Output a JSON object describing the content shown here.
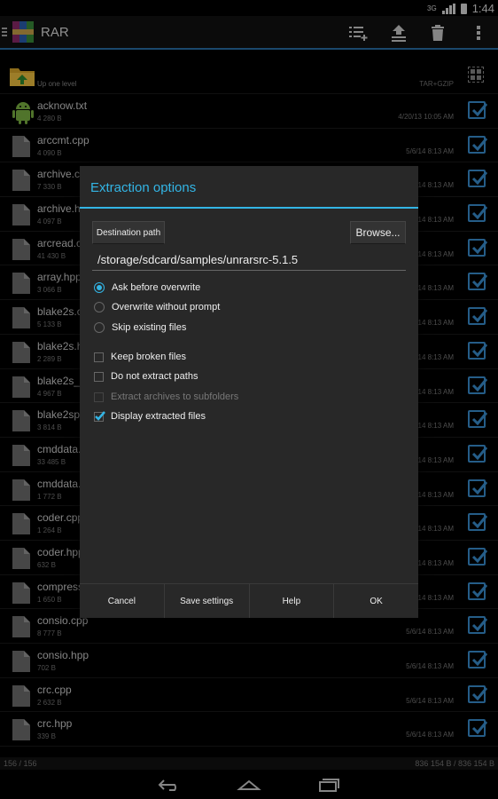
{
  "status_bar": {
    "network": "3G",
    "time": "1:44"
  },
  "app": {
    "title": "RAR"
  },
  "toolbar": {
    "actions": [
      {
        "name": "select-all-icon"
      },
      {
        "name": "upload-icon"
      },
      {
        "name": "trash-icon"
      },
      {
        "name": "overflow-menu-icon"
      }
    ]
  },
  "up_row": {
    "label": "Up one level",
    "format": "TAR+GZIP"
  },
  "files": [
    {
      "name": "acknow.txt",
      "size": "4 280 B",
      "date": "4/20/13 10:05 AM"
    },
    {
      "name": "arccmt.cpp",
      "size": "4 090 B",
      "date": "5/6/14 8:13 AM"
    },
    {
      "name": "archive.cpp",
      "size": "7 330 B",
      "date": "5/6/14 8:13 AM"
    },
    {
      "name": "archive.hpp",
      "size": "4 097 B",
      "date": "5/6/14 8:13 AM"
    },
    {
      "name": "arcread.cpp",
      "size": "41 430 B",
      "date": "5/6/14 8:13 AM"
    },
    {
      "name": "array.hpp",
      "size": "3 066 B",
      "date": "5/6/14 8:13 AM"
    },
    {
      "name": "blake2s.cpp",
      "size": "5 133 B",
      "date": "5/6/14 8:13 AM"
    },
    {
      "name": "blake2s.hpp",
      "size": "2 289 B",
      "date": "5/6/14 8:13 AM"
    },
    {
      "name": "blake2s_sse.cpp",
      "size": "4 967 B",
      "date": "5/6/14 8:13 AM"
    },
    {
      "name": "blake2sp.cpp",
      "size": "3 814 B",
      "date": "5/6/14 8:13 AM"
    },
    {
      "name": "cmddata.cpp",
      "size": "33 485 B",
      "date": "5/6/14 8:13 AM"
    },
    {
      "name": "cmddata.hpp",
      "size": "1 772 B",
      "date": "5/6/14 8:13 AM"
    },
    {
      "name": "coder.cpp",
      "size": "1 264 B",
      "date": "5/6/14 8:13 AM"
    },
    {
      "name": "coder.hpp",
      "size": "632 B",
      "date": "5/6/14 8:13 AM"
    },
    {
      "name": "compress.hpp",
      "size": "1 650 B",
      "date": "5/6/14 8:13 AM"
    },
    {
      "name": "consio.cpp",
      "size": "8 777 B",
      "date": "5/6/14 8:13 AM"
    },
    {
      "name": "consio.hpp",
      "size": "702 B",
      "date": "5/6/14 8:13 AM"
    },
    {
      "name": "crc.cpp",
      "size": "2 632 B",
      "date": "5/6/14 8:13 AM"
    },
    {
      "name": "crc.hpp",
      "size": "339 B",
      "date": "5/6/14 8:13 AM"
    }
  ],
  "footer": {
    "count": "156 / 156",
    "total": "836 154 B / 836 154 B"
  },
  "dialog": {
    "title": "Extraction options",
    "destination_label": "Destination path",
    "browse_label": "Browse...",
    "path": "/storage/sdcard/samples/unrarsrc-5.1.5",
    "overwrite_options": [
      {
        "label": "Ask before overwrite",
        "selected": true
      },
      {
        "label": "Overwrite without prompt",
        "selected": false
      },
      {
        "label": "Skip existing files",
        "selected": false
      }
    ],
    "checkboxes": [
      {
        "label": "Keep broken files",
        "checked": false,
        "enabled": true
      },
      {
        "label": "Do not extract paths",
        "checked": false,
        "enabled": true
      },
      {
        "label": "Extract archives to subfolders",
        "checked": false,
        "enabled": false
      },
      {
        "label": "Display extracted files",
        "checked": true,
        "enabled": true
      }
    ],
    "buttons": {
      "cancel": "Cancel",
      "save": "Save settings",
      "help": "Help",
      "ok": "OK"
    }
  },
  "colors": {
    "accent": "#33b5e5",
    "checkbox": "#3a8fd1",
    "dialog_bg": "#282828"
  }
}
